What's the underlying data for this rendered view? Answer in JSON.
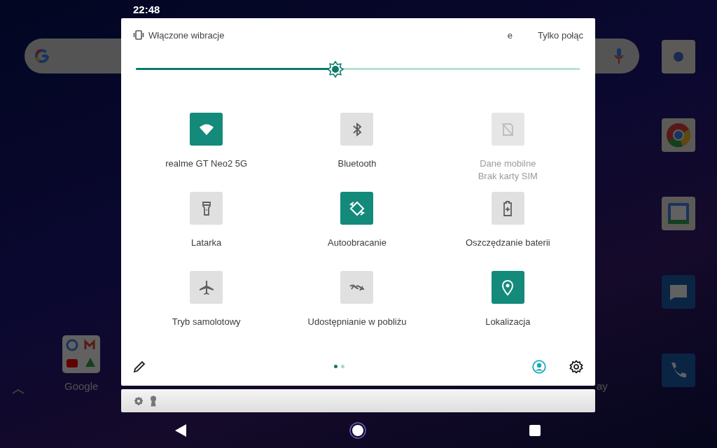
{
  "status_bar": {
    "time": "22:48"
  },
  "home_screen": {
    "folder_label": "Google",
    "partial_label": "ay"
  },
  "quick_settings": {
    "ringer": "Włączone wibracje",
    "header_items": [
      "e",
      "Tylko połąc"
    ],
    "brightness": {
      "level": 0.45
    },
    "tiles": [
      {
        "kind": "wifi",
        "label": "realme GT Neo2 5G",
        "on": true,
        "disabled": false
      },
      {
        "kind": "bluetooth",
        "label": "Bluetooth",
        "on": false,
        "disabled": false
      },
      {
        "kind": "sim",
        "label": "Dane mobilne",
        "sublabel": "Brak karty SIM",
        "on": false,
        "disabled": true
      },
      {
        "kind": "flashlight",
        "label": "Latarka",
        "on": false,
        "disabled": false
      },
      {
        "kind": "rotate",
        "label": "Autoobracanie",
        "on": true,
        "disabled": false
      },
      {
        "kind": "battery",
        "label": "Oszczędzanie baterii",
        "on": false,
        "disabled": false
      },
      {
        "kind": "airplane",
        "label": "Tryb samolotowy",
        "on": false,
        "disabled": false
      },
      {
        "kind": "nearby",
        "label": "Udostępnianie w pobliżu",
        "on": false,
        "disabled": false
      },
      {
        "kind": "location",
        "label": "Lokalizacja",
        "on": true,
        "disabled": false
      }
    ],
    "pages": [
      {
        "selected": true
      },
      {
        "selected": false
      }
    ]
  }
}
